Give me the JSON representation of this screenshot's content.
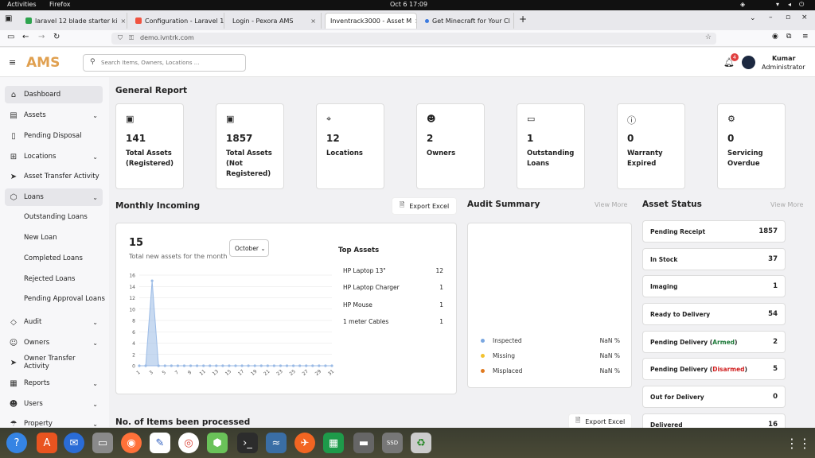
{
  "system": {
    "activities": "Activities",
    "app": "Firefox",
    "clock": "Oct 6  17:09"
  },
  "browser": {
    "tabs": [
      {
        "title": "laravel 12 blade starter ki",
        "color": "#2da44e"
      },
      {
        "title": "Configuration - Laravel 1:",
        "color": "#f05340"
      },
      {
        "title": "Login - Pexora AMS",
        "color": "#999999"
      },
      {
        "title": "Inventrack3000 - Asset M",
        "color": "#cccccc"
      },
      {
        "title": "Get Minecraft for Your Cl",
        "color": "#3d7be0"
      }
    ],
    "url": "demo.ivntrk.com",
    "new_tab": "+"
  },
  "header": {
    "logo": "AMS",
    "search_placeholder": "Search Items, Owners, Locations ...",
    "notification_count": "4",
    "user_name": "Kumar",
    "user_role": "Administrator"
  },
  "sidebar": {
    "items": [
      {
        "label": "Dashboard",
        "icon": "home-icon"
      },
      {
        "label": "Assets",
        "icon": "layers-icon"
      },
      {
        "label": "Pending Disposal",
        "icon": "clipboard-icon"
      },
      {
        "label": "Locations",
        "icon": "map-icon"
      },
      {
        "label": "Asset Transfer Activity",
        "icon": "send-icon"
      },
      {
        "label": "Loans",
        "icon": "box-icon"
      },
      {
        "label": "Audit",
        "icon": "tag-icon"
      },
      {
        "label": "Owners",
        "icon": "users-icon"
      },
      {
        "label": "Owner Transfer Activity",
        "icon": "send-icon"
      },
      {
        "label": "Reports",
        "icon": "chart-icon"
      },
      {
        "label": "Users",
        "icon": "user-icon"
      },
      {
        "label": "Property",
        "icon": "umbrella-icon"
      }
    ],
    "loan_subitems": [
      "Outstanding Loans",
      "New Loan",
      "Completed Loans",
      "Rejected Loans",
      "Pending Approval Loans"
    ]
  },
  "general_report": {
    "title": "General Report",
    "cards": [
      {
        "value": "141",
        "label": "Total Assets (Registered)",
        "icon": "briefcase-icon"
      },
      {
        "value": "1857",
        "label": "Total Assets (Not Registered)",
        "icon": "briefcase-icon"
      },
      {
        "value": "12",
        "label": "Locations",
        "icon": "pin-icon"
      },
      {
        "value": "2",
        "label": "Owners",
        "icon": "users-icon"
      },
      {
        "value": "1",
        "label": "Outstanding Loans",
        "icon": "archive-icon"
      },
      {
        "value": "0",
        "label": "Warranty Expired",
        "icon": "alert-icon"
      },
      {
        "value": "0",
        "label": "Servicing Overdue",
        "icon": "settings-icon"
      }
    ]
  },
  "monthly_incoming": {
    "title": "Monthly Incoming",
    "export_label": "Export Excel",
    "total": "15",
    "subtitle": "Total new assets for the month",
    "month": "October",
    "top_assets_title": "Top Assets",
    "top_assets": [
      {
        "name": "HP Laptop 13\"",
        "count": "12"
      },
      {
        "name": "HP Laptop Charger",
        "count": "1"
      },
      {
        "name": "HP Mouse",
        "count": "1"
      },
      {
        "name": "1 meter Cables",
        "count": "1"
      }
    ]
  },
  "chart_data": {
    "type": "area",
    "x": [
      1,
      2,
      3,
      4,
      5,
      6,
      7,
      8,
      9,
      10,
      11,
      12,
      13,
      14,
      15,
      16,
      17,
      18,
      19,
      20,
      21,
      22,
      23,
      24,
      25,
      26,
      27,
      28,
      29,
      30,
      31
    ],
    "values": [
      0,
      0,
      15,
      0,
      0,
      0,
      0,
      0,
      0,
      0,
      0,
      0,
      0,
      0,
      0,
      0,
      0,
      0,
      0,
      0,
      0,
      0,
      0,
      0,
      0,
      0,
      0,
      0,
      0,
      0,
      0
    ],
    "xticks": [
      "1",
      "3",
      "5",
      "7",
      "9",
      "11",
      "13",
      "15",
      "17",
      "19",
      "21",
      "23",
      "25",
      "27",
      "29",
      "31"
    ],
    "yticks": [
      "0",
      "2",
      "4",
      "6",
      "8",
      "10",
      "12",
      "14",
      "16"
    ],
    "ylim": [
      0,
      16
    ],
    "color": "#9bbbe6"
  },
  "audit": {
    "title": "Audit Summary",
    "view_more": "View More",
    "rows": [
      {
        "label": "Inspected",
        "value": "NaN %",
        "color": "#7aa7e0"
      },
      {
        "label": "Missing",
        "value": "NaN %",
        "color": "#f2c230"
      },
      {
        "label": "Misplaced",
        "value": "NaN %",
        "color": "#e07a20"
      }
    ]
  },
  "asset_status": {
    "title": "Asset Status",
    "view_more": "View More",
    "rows": [
      {
        "label": "Pending Receipt",
        "note": "",
        "note_color": "",
        "value": "1857"
      },
      {
        "label": "In Stock",
        "note": "",
        "note_color": "",
        "value": "37"
      },
      {
        "label": "Imaging",
        "note": "",
        "note_color": "",
        "value": "1"
      },
      {
        "label": "Ready to Delivery",
        "note": "",
        "note_color": "",
        "value": "54"
      },
      {
        "label": "Pending Delivery (",
        "note": "Armed",
        "note_color": "#1e7a3a",
        "value": "2",
        "close": ")"
      },
      {
        "label": "Pending Delivery (",
        "note": "Disarmed",
        "note_color": "#d02020",
        "value": "5",
        "close": ")"
      },
      {
        "label": "Out for Delivery",
        "note": "",
        "note_color": "",
        "value": "0"
      },
      {
        "label": "Delivered",
        "note": "",
        "note_color": "",
        "value": "16"
      }
    ]
  },
  "processed": {
    "title": "No. of Items been processed",
    "export_label": "Export Excel"
  }
}
